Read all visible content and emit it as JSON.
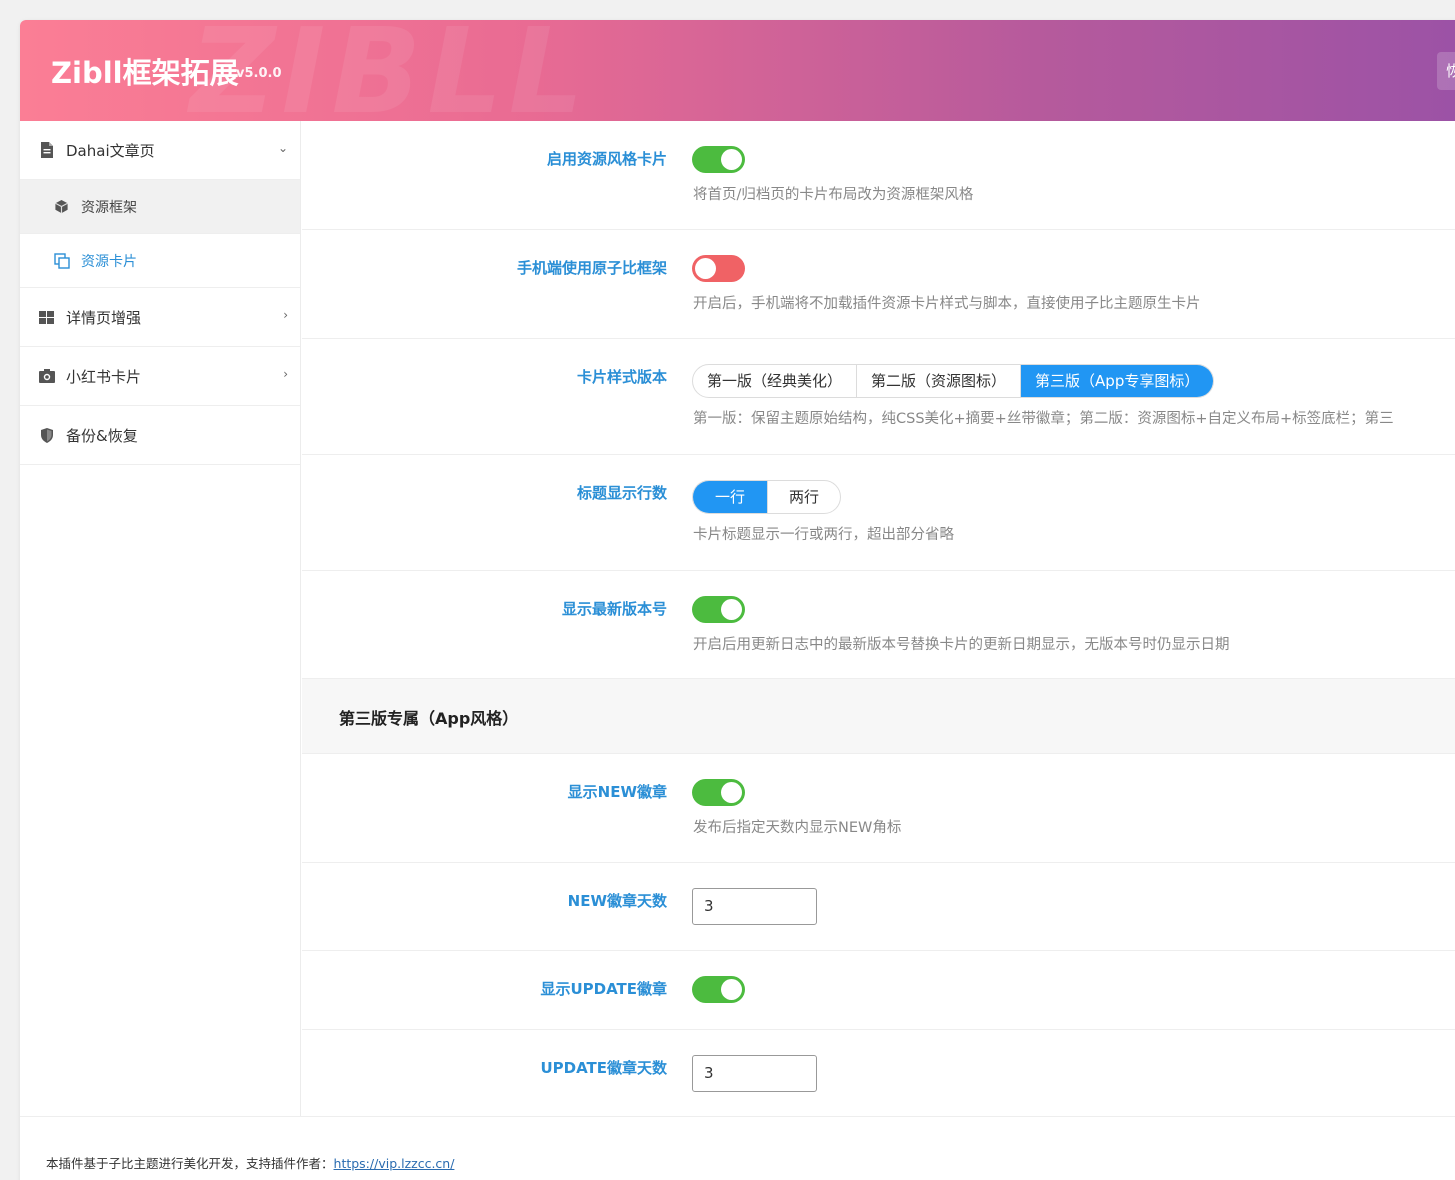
{
  "header": {
    "title": "Zibll框架拓展",
    "version": "v5.0.0",
    "watermark": "ZIBLL",
    "edge_button": "恢"
  },
  "sidebar": {
    "items": [
      {
        "label": "Dahai文章页",
        "icon": "document-icon",
        "arrow": "⌄"
      },
      {
        "label": "资源框架",
        "icon": "cube-icon"
      },
      {
        "label": "资源卡片",
        "icon": "copy-icon"
      },
      {
        "label": "详情页增强",
        "icon": "grid-icon",
        "arrow": "›"
      },
      {
        "label": "小红书卡片",
        "icon": "camera-icon",
        "arrow": "›"
      },
      {
        "label": "备份&恢复",
        "icon": "shield-icon"
      }
    ]
  },
  "settings": {
    "enable_card": {
      "label": "启用资源风格卡片",
      "desc": "将首页/归档页的卡片布局改为资源框架风格",
      "on": true
    },
    "mobile_native": {
      "label": "手机端使用原子比框架",
      "desc": "开启后，手机端将不加载插件资源卡片样式与脚本，直接使用子比主题原生卡片",
      "on": false
    },
    "card_version": {
      "label": "卡片样式版本",
      "options": [
        "第一版（经典美化）",
        "第二版（资源图标）",
        "第三版（App专享图标）"
      ],
      "selected": 2,
      "desc": "第一版：保留主题原始结构，纯CSS美化+摘要+丝带徽章；第二版：资源图标+自定义布局+标签底栏；第三"
    },
    "title_lines": {
      "label": "标题显示行数",
      "options": [
        "一行",
        "两行"
      ],
      "selected": 0,
      "desc": "卡片标题显示一行或两行，超出部分省略"
    },
    "show_version": {
      "label": "显示最新版本号",
      "desc": "开启后用更新日志中的最新版本号替换卡片的更新日期显示，无版本号时仍显示日期",
      "on": true
    },
    "section_v3": "第三版专属（App风格）",
    "show_new": {
      "label": "显示NEW徽章",
      "desc": "发布后指定天数内显示NEW角标",
      "on": true
    },
    "new_days": {
      "label": "NEW徽章天数",
      "value": "3"
    },
    "show_update": {
      "label": "显示UPDATE徽章",
      "on": true
    },
    "update_days": {
      "label": "UPDATE徽章天数",
      "value": "3"
    }
  },
  "footer": {
    "text": "本插件基于子比主题进行美化开发，支持插件作者：",
    "link": "https://vip.lzzcc.cn/"
  },
  "colors": {
    "accent": "#2b8fd6",
    "toggle_on": "#4cbb3f",
    "toggle_off": "#f06265",
    "selected": "#2196f3"
  }
}
